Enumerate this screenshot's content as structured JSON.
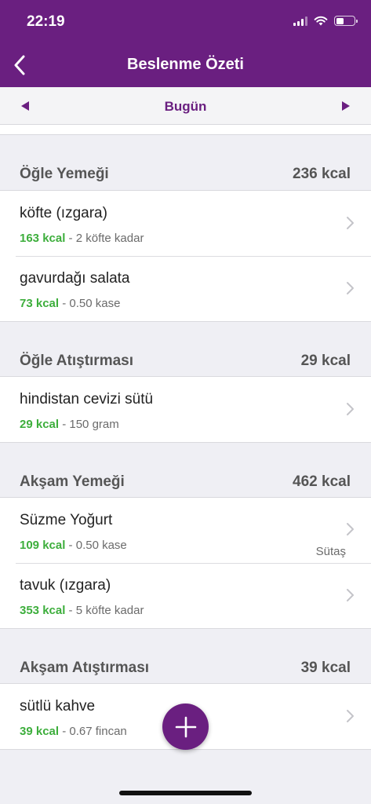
{
  "status": {
    "time": "22:19"
  },
  "header": {
    "title": "Beslenme Özeti",
    "back_icon": "chevron-left-icon"
  },
  "date_bar": {
    "label": "Bugün",
    "prev_icon": "triangle-left-icon",
    "next_icon": "triangle-right-icon"
  },
  "colors": {
    "brand": "#6a1f80",
    "kcal_green": "#3dae3c",
    "background": "#efeff4"
  },
  "meals": [
    {
      "name": "Öğle Yemeği",
      "kcal": "236 kcal",
      "items": [
        {
          "name": "köfte (ızgara)",
          "kcal": "163 kcal",
          "portion": " - 2 köfte kadar",
          "brand": ""
        },
        {
          "name": "gavurdağı salata",
          "kcal": "73 kcal",
          "portion": " - 0.50 kase",
          "brand": ""
        }
      ]
    },
    {
      "name": "Öğle Atıştırması",
      "kcal": "29 kcal",
      "items": [
        {
          "name": "hindistan cevizi sütü",
          "kcal": "29 kcal",
          "portion": " - 150 gram",
          "brand": ""
        }
      ]
    },
    {
      "name": "Akşam Yemeği",
      "kcal": "462 kcal",
      "items": [
        {
          "name": "Süzme Yoğurt",
          "kcal": "109 kcal",
          "portion": " - 0.50 kase",
          "brand": "Sütaş"
        },
        {
          "name": "tavuk (ızgara)",
          "kcal": "353 kcal",
          "portion": " - 5 köfte kadar",
          "brand": ""
        }
      ]
    },
    {
      "name": "Akşam Atıştırması",
      "kcal": "39 kcal",
      "items": [
        {
          "name": "sütlü kahve",
          "kcal": "39 kcal",
          "portion": " - 0.67 fincan",
          "brand": ""
        }
      ]
    }
  ],
  "fab": {
    "icon": "plus-icon"
  }
}
